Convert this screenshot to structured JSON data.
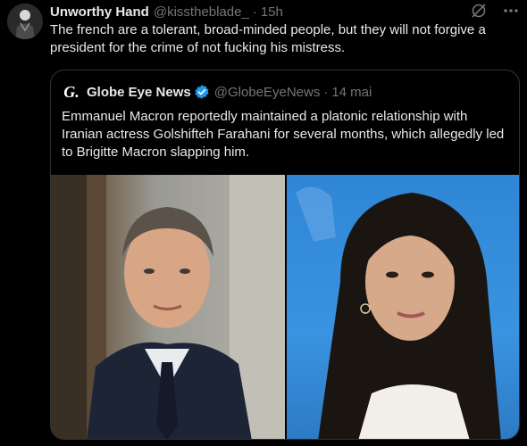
{
  "tweet": {
    "author_name": "Unworthy Hand",
    "author_handle": "@kisstheblade_",
    "separator": "·",
    "time": "15h",
    "text": "The french are a tolerant, broad-minded people, but they will not forgive a president for the crime of not fucking his mistress."
  },
  "quote": {
    "avatar_letter": "G.",
    "author_name": "Globe Eye News",
    "author_handle": "@GlobeEyeNews",
    "separator": "·",
    "time": "14 mai",
    "text": "Emmanuel Macron reportedly maintained a platonic relationship with Iranian actress Golshifteh Farahani for several months, which allegedly led to Brigitte Macron slapping him."
  },
  "icons": {
    "grok": "grok-icon",
    "more": "more-icon",
    "verified": "verified-badge-icon"
  },
  "colors": {
    "background": "#000000",
    "text": "#e7e9ea",
    "secondary": "#71767b",
    "border": "#2f3336",
    "verified": "#1d9bf0"
  }
}
